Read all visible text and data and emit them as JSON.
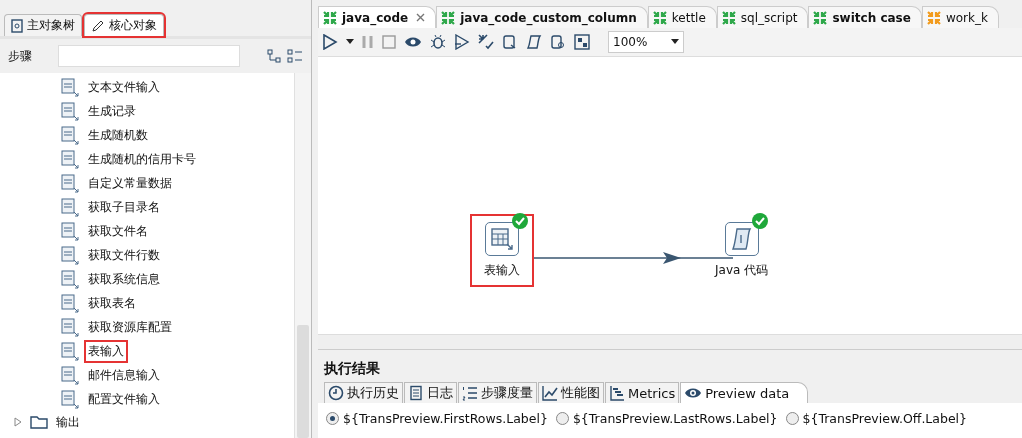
{
  "left_panel": {
    "tabs": [
      {
        "label": "主对象树",
        "selected": false,
        "highlighted": false
      },
      {
        "label": "核心对象",
        "selected": true,
        "highlighted": true
      }
    ],
    "search": {
      "label": "步骤"
    },
    "steps": [
      {
        "label": "文本文件输入",
        "highlighted": false
      },
      {
        "label": "生成记录",
        "highlighted": false
      },
      {
        "label": "生成随机数",
        "highlighted": false
      },
      {
        "label": "生成随机的信用卡号",
        "highlighted": false
      },
      {
        "label": "自定义常量数据",
        "highlighted": false
      },
      {
        "label": "获取子目录名",
        "highlighted": false
      },
      {
        "label": "获取文件名",
        "highlighted": false
      },
      {
        "label": "获取文件行数",
        "highlighted": false
      },
      {
        "label": "获取系统信息",
        "highlighted": false
      },
      {
        "label": "获取表名",
        "highlighted": false
      },
      {
        "label": "获取资源库配置",
        "highlighted": false
      },
      {
        "label": "表输入",
        "highlighted": true
      },
      {
        "label": "邮件信息输入",
        "highlighted": false
      },
      {
        "label": "配置文件输入",
        "highlighted": false
      }
    ],
    "folders": [
      {
        "label": "输出",
        "expanded": false
      }
    ]
  },
  "editor_tabs": [
    {
      "label": "java_code",
      "selected": true,
      "bold": true,
      "kind": "transformation"
    },
    {
      "label": "java_code_custom_column",
      "selected": false,
      "bold": true,
      "kind": "transformation"
    },
    {
      "label": "kettle",
      "selected": false,
      "bold": false,
      "kind": "transformation"
    },
    {
      "label": "sql_script",
      "selected": false,
      "bold": false,
      "kind": "transformation"
    },
    {
      "label": "switch case",
      "selected": false,
      "bold": true,
      "kind": "transformation"
    },
    {
      "label": "work_k",
      "selected": false,
      "bold": false,
      "kind": "job"
    }
  ],
  "toolbar": {
    "zoom": "100%"
  },
  "canvas": {
    "nodes": [
      {
        "label": "表输入",
        "kind": "table",
        "highlighted": true,
        "ok": true
      },
      {
        "label": "Java 代码",
        "kind": "script",
        "highlighted": false,
        "ok": true
      }
    ]
  },
  "results": {
    "title": "执行结果",
    "tabs": [
      {
        "label": "执行历史",
        "selected": false,
        "kind": "history"
      },
      {
        "label": "日志",
        "selected": false,
        "kind": "log"
      },
      {
        "label": "步骤度量",
        "selected": false,
        "kind": "metrics-list"
      },
      {
        "label": "性能图",
        "selected": false,
        "kind": "chart"
      },
      {
        "label": "Metrics",
        "selected": false,
        "kind": "gantt"
      },
      {
        "label": "Preview data",
        "selected": true,
        "kind": "preview"
      }
    ],
    "options": [
      {
        "label": "${TransPreview.FirstRows.Label}",
        "selected": true
      },
      {
        "label": "${TransPreview.LastRows.Label}",
        "selected": false
      },
      {
        "label": "${TransPreview.Off.Label}",
        "selected": false
      }
    ]
  }
}
